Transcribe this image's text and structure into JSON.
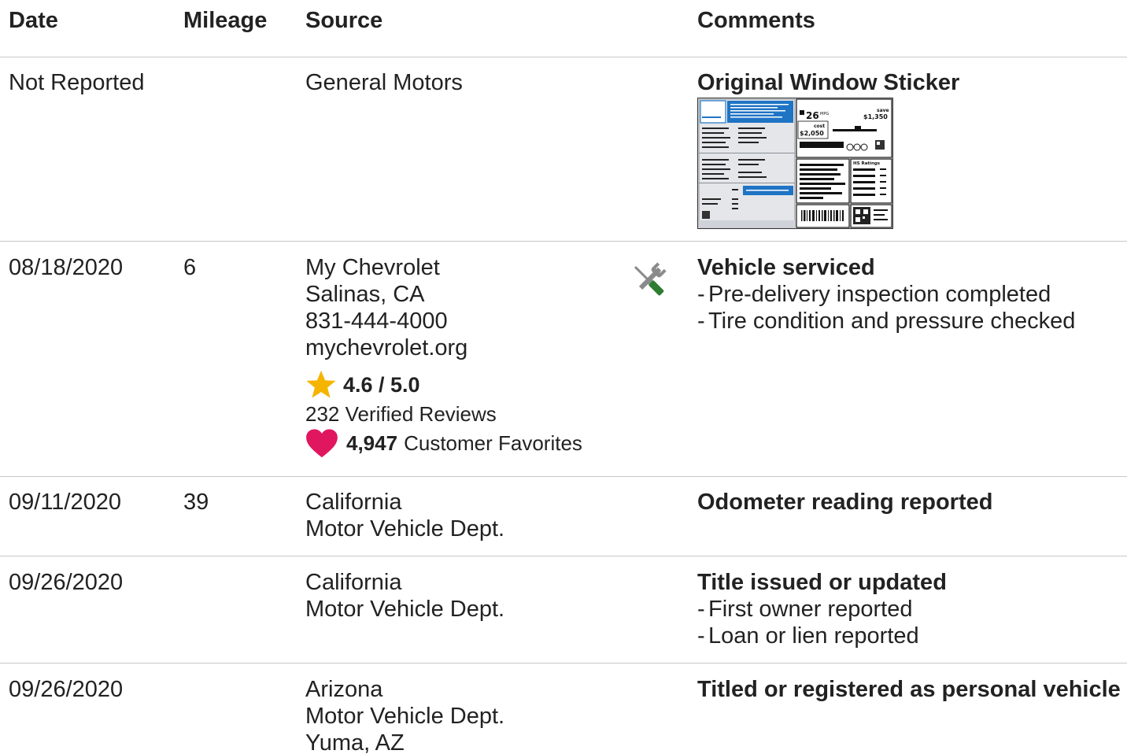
{
  "header": {
    "date": "Date",
    "mileage": "Mileage",
    "source": "Source",
    "comments": "Comments"
  },
  "rows": [
    {
      "date": "Not Reported",
      "mileage": "",
      "source": [
        "General Motors"
      ],
      "comment_title": "Original Window Sticker",
      "sticker": {
        "mpg": "26",
        "mpg_unit": "MPG",
        "save_label": "save",
        "save_amount": "$1,350",
        "cost_label": "cost",
        "cost_amount": "$2,050",
        "ratings_label": "HS Ratings"
      }
    },
    {
      "date": "08/18/2020",
      "mileage": "6",
      "source": [
        "My Chevrolet",
        "Salinas, CA",
        "831-444-4000",
        "mychevrolet.org"
      ],
      "rating": "4.6 / 5.0",
      "reviews": "232 Verified Reviews",
      "favorites_count": "4,947",
      "favorites_label": "Customer Favorites",
      "icon": "service-tools-icon",
      "comment_title": "Vehicle serviced",
      "comment_items": [
        "Pre-delivery inspection completed",
        "Tire condition and pressure checked"
      ]
    },
    {
      "date": "09/11/2020",
      "mileage": "39",
      "source": [
        "California",
        "Motor Vehicle Dept."
      ],
      "comment_title": "Odometer reading reported"
    },
    {
      "date": "09/26/2020",
      "mileage": "",
      "source": [
        "California",
        "Motor Vehicle Dept."
      ],
      "comment_title": "Title issued or updated",
      "comment_items": [
        "First owner reported",
        "Loan or lien reported"
      ]
    },
    {
      "date": "09/26/2020",
      "mileage": "",
      "source": [
        "Arizona",
        "Motor Vehicle Dept.",
        "Yuma, AZ"
      ],
      "comment_title": "Titled or registered as personal vehicle"
    }
  ],
  "colors": {
    "star": "#f5b400",
    "heart": "#e0175f",
    "wrench": "#8a8a8a",
    "screwdriver": "#2f7d32",
    "sticker_blue": "#1f74c4",
    "divider": "#c7c7c7"
  }
}
